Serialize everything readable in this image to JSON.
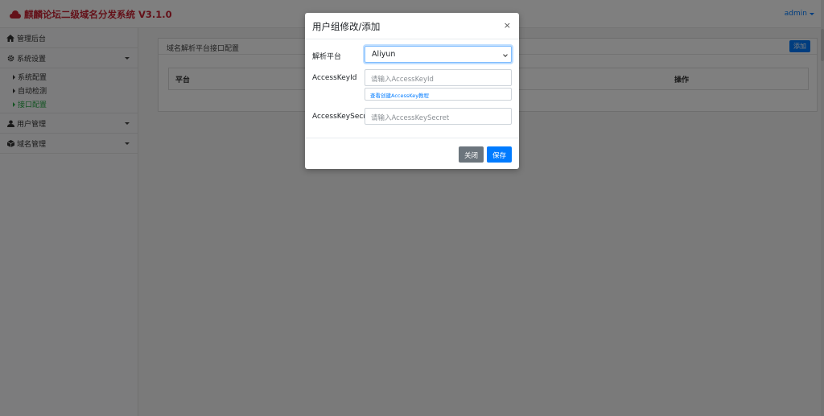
{
  "navbar": {
    "brand": "麒麟论坛二级域名分发系统 V3.1.0",
    "user": "admin",
    "brand_color": "#c82333"
  },
  "sidebar": {
    "items": [
      {
        "icon": "home-icon",
        "label": "管理后台"
      },
      {
        "icon": "gear-icon",
        "label": "系统设置",
        "expanded": true,
        "children": [
          "系统配置",
          "自动检测",
          "接口配置"
        ],
        "active_child": "接口配置"
      },
      {
        "icon": "user-icon",
        "label": "用户管理"
      },
      {
        "icon": "cube-icon",
        "label": "域名管理"
      }
    ]
  },
  "main": {
    "card_title": "域名解析平台接口配置",
    "add_label": "添加",
    "table_headers": [
      "平台",
      "操作"
    ]
  },
  "modal": {
    "title": "用户组修改/添加",
    "close_symbol": "×",
    "platform_label": "解析平台",
    "platform_value": "Aliyun",
    "keyid_label": "AccessKeyId",
    "keyid_placeholder": "请输入AccessKeyId",
    "keyid_help": "查看创建AccessKey教程",
    "secret_label": "AccessKeySecret",
    "secret_placeholder": "请输入AccessKeySecret",
    "close_label": "关闭",
    "save_label": "保存"
  },
  "colors": {
    "primary": "#007bff",
    "secondary": "#6c757d",
    "active": "#28a745"
  }
}
